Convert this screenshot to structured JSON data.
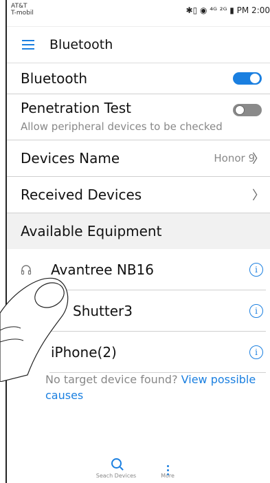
{
  "status_bar": {
    "carrier_line1": "AT&T",
    "carrier_line2": "T-mobil",
    "right_text": "✱▯ ◉ ⁴ᴳ ²ᴳ ▮ PM 2:00"
  },
  "app_bar": {
    "title": "Bluetooth"
  },
  "settings": {
    "bluetooth": {
      "label": "Bluetooth",
      "enabled": true
    },
    "penetration": {
      "label": "Penetration Test",
      "subtitle": "Allow peripheral devices to be checked",
      "enabled": false
    },
    "devices_name": {
      "label": "Devices Name",
      "value": "Honor 9"
    },
    "received": {
      "label": "Received Devices"
    }
  },
  "available": {
    "header": "Available Equipment",
    "devices": [
      {
        "name": "Avantree NB16",
        "icon": "headphones-icon"
      },
      {
        "name": "Shutter3",
        "icon": "device-icon"
      },
      {
        "name": "iPhone(2)",
        "icon": "phone-icon"
      }
    ]
  },
  "help": {
    "text": "No target device found? ",
    "link": "View possible causes"
  },
  "bottom_nav": {
    "search": "Seach Devices",
    "more": "More"
  },
  "colors": {
    "accent": "#1a7fe0",
    "toggle_off": "#8a8a8a"
  }
}
